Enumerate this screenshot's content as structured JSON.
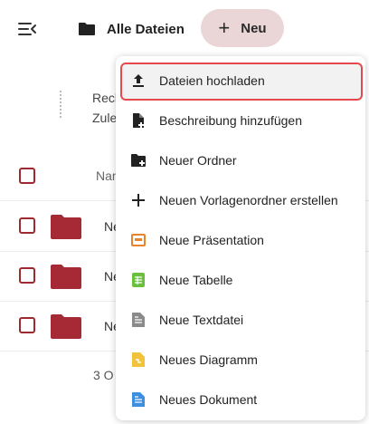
{
  "header": {
    "breadcrumb": "Alle Dateien",
    "new_button_label": "Neu",
    "menu_toggle_icon": "menu-collapse-icon"
  },
  "list": {
    "hint_line1": "Rech",
    "hint_line2": "Zule",
    "column_name": "Nam",
    "rows": [
      {
        "name": "Ne"
      },
      {
        "name": "Ne"
      },
      {
        "name": "Ne"
      }
    ],
    "footer": "3 O",
    "folder_color": "#a52a35"
  },
  "new_menu": {
    "items": [
      {
        "label": "Dateien hochladen",
        "icon": "upload-icon",
        "highlighted": true
      },
      {
        "label": "Beschreibung hinzufügen",
        "icon": "file-add-icon"
      },
      {
        "label": "Neuer Ordner",
        "icon": "folder-add-icon"
      },
      {
        "label": "Neuen Vorlagenordner erstellen",
        "icon": "plus-icon"
      },
      {
        "label": "Neue Präsentation",
        "icon": "presentation-icon",
        "color": "#e8822d"
      },
      {
        "label": "Neue Tabelle",
        "icon": "spreadsheet-icon",
        "color": "#6abf3d"
      },
      {
        "label": "Neue Textdatei",
        "icon": "text-file-icon",
        "color": "#8a8a8a"
      },
      {
        "label": "Neues Diagramm",
        "icon": "diagram-icon",
        "color": "#f2c23a"
      },
      {
        "label": "Neues Dokument",
        "icon": "document-icon",
        "color": "#3d8fe0"
      }
    ]
  },
  "colors": {
    "accent": "#9e2a2f",
    "new_button_bg": "#ead6d6",
    "highlight_border": "#e5484d"
  }
}
